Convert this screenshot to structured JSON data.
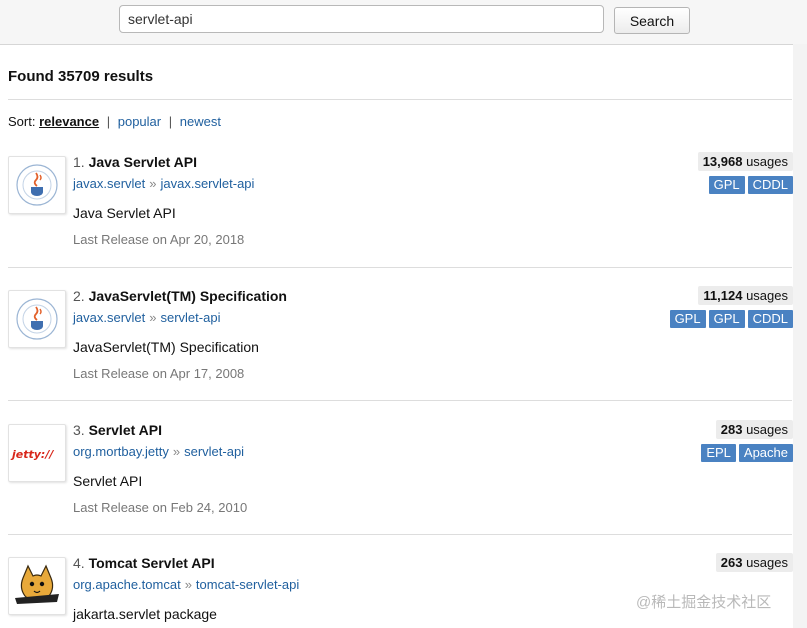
{
  "search": {
    "value": "servlet-api",
    "button_label": "Search"
  },
  "found_text": "Found 35709 results",
  "sort": {
    "label": "Sort:",
    "active": "relevance",
    "options": [
      "popular",
      "newest"
    ],
    "separator": "|"
  },
  "results": [
    {
      "number": "1.",
      "title": "Java Servlet API",
      "group": "javax.servlet",
      "artifact": "javax.servlet-api",
      "description": "Java Servlet API",
      "release": "Last Release on Apr 20, 2018",
      "usages_count": "13,968",
      "usages_label": "usages",
      "licenses": [
        "GPL",
        "CDDL"
      ],
      "logo": "java-community-process-logo"
    },
    {
      "number": "2.",
      "title": "JavaServlet(TM) Specification",
      "group": "javax.servlet",
      "artifact": "servlet-api",
      "description": "JavaServlet(TM) Specification",
      "release": "Last Release on Apr 17, 2008",
      "usages_count": "11,124",
      "usages_label": "usages",
      "licenses": [
        "GPL",
        "GPL",
        "CDDL"
      ],
      "logo": "java-community-process-logo"
    },
    {
      "number": "3.",
      "title": "Servlet API",
      "group": "org.mortbay.jetty",
      "artifact": "servlet-api",
      "description": "Servlet API",
      "release": "Last Release on Feb 24, 2010",
      "usages_count": "283",
      "usages_label": "usages",
      "licenses": [
        "EPL",
        "Apache"
      ],
      "logo": "jetty-logo",
      "logo_text": "jetty://"
    },
    {
      "number": "4.",
      "title": "Tomcat Servlet API",
      "group": "org.apache.tomcat",
      "artifact": "tomcat-servlet-api",
      "description": "jakarta.servlet package",
      "usages_count": "263",
      "usages_label": "usages",
      "licenses": [],
      "logo": "tomcat-logo"
    }
  ],
  "coord_arrow": "»",
  "watermark": "@稀土掘金技术社区",
  "colors": {
    "link": "#1f5f9e",
    "license_badge": "#4a82c2"
  }
}
